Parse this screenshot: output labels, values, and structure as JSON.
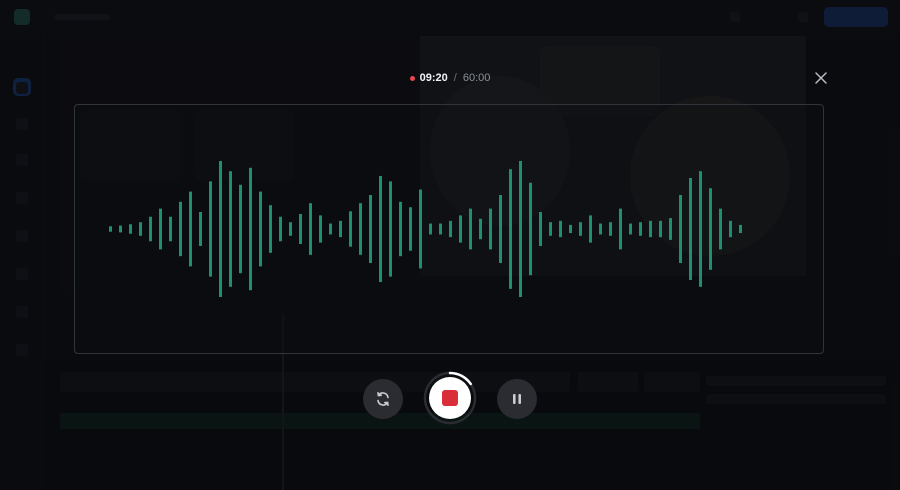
{
  "recorder": {
    "elapsed": "09:20",
    "separator": "/",
    "total": "60:00",
    "progress_fraction": 0.155
  },
  "colors": {
    "waveform": "#1f8f72",
    "recording_dot": "#e5484d",
    "stop_square": "#d92d3a"
  },
  "icons": {
    "restart": "restart-icon",
    "stop": "stop-icon",
    "pause": "pause-icon",
    "close": "close-icon"
  },
  "waveform": {
    "amplitudes": [
      0.04,
      0.05,
      0.07,
      0.1,
      0.18,
      0.3,
      0.18,
      0.4,
      0.55,
      0.25,
      0.7,
      1.0,
      0.85,
      0.65,
      0.9,
      0.55,
      0.35,
      0.18,
      0.1,
      0.22,
      0.38,
      0.2,
      0.08,
      0.12,
      0.26,
      0.38,
      0.5,
      0.78,
      0.7,
      0.4,
      0.32,
      0.58,
      0.08,
      0.08,
      0.12,
      0.2,
      0.3,
      0.15,
      0.3,
      0.5,
      0.88,
      1.0,
      0.68,
      0.25,
      0.1,
      0.12,
      0.06,
      0.1,
      0.2,
      0.08,
      0.1,
      0.3,
      0.08,
      0.1,
      0.12,
      0.12,
      0.16,
      0.5,
      0.75,
      0.85,
      0.6,
      0.3,
      0.12,
      0.06
    ]
  }
}
